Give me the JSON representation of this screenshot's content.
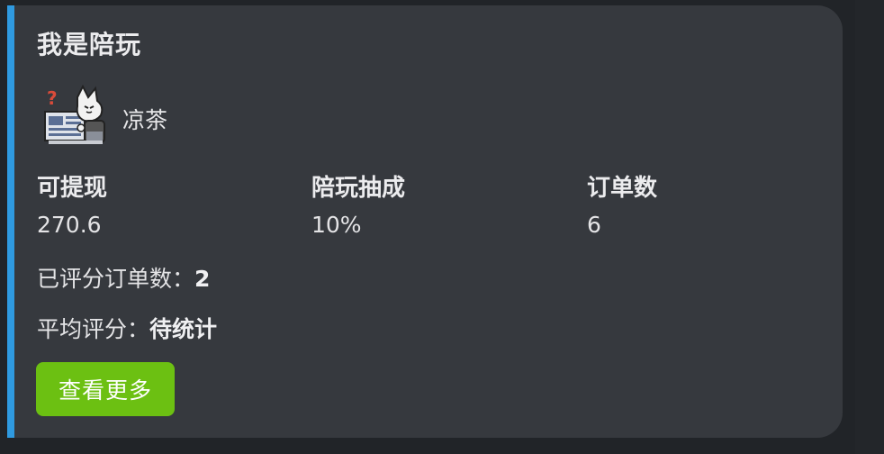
{
  "card": {
    "title": "我是陪玩",
    "username": "凉茶",
    "avatar_icon": "cat-reading-newspaper-avatar",
    "accent_color": "#2f9ae0"
  },
  "stats": [
    {
      "label": "可提现",
      "value": "270.6"
    },
    {
      "label": "陪玩抽成",
      "value": "10%"
    },
    {
      "label": "订单数",
      "value": "6"
    }
  ],
  "rated_orders": {
    "label": "已评分订单数：",
    "value": "2"
  },
  "avg_rating": {
    "label": "平均评分：",
    "value": "待统计"
  },
  "more_button": {
    "label": "查看更多",
    "color": "#6cc012"
  }
}
